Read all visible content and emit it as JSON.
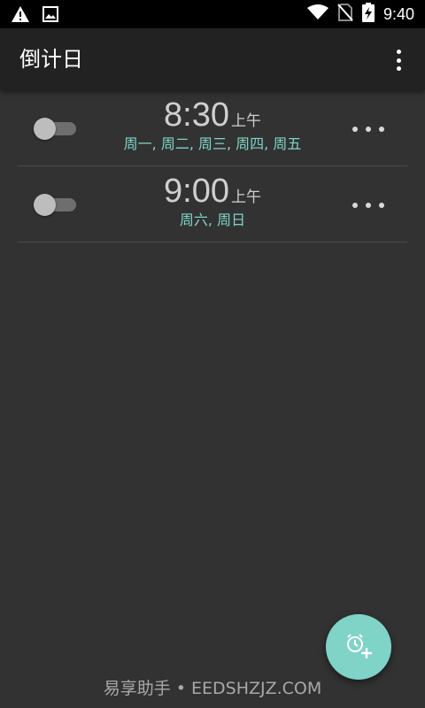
{
  "status_bar": {
    "time": "9:40",
    "icons": [
      "warning-icon",
      "image-icon",
      "wifi-icon",
      "no-sim-icon",
      "battery-charging-icon"
    ]
  },
  "app_bar": {
    "title": "倒计日",
    "menu_icon": "overflow-menu-icon"
  },
  "alarms": [
    {
      "time": "8:30",
      "ampm": "上午",
      "days": "周一, 周二, 周三, 周四, 周五",
      "enabled": false
    },
    {
      "time": "9:00",
      "ampm": "上午",
      "days": "周六, 周日",
      "enabled": false
    }
  ],
  "fab": {
    "icon": "add-alarm-icon"
  },
  "watermark": "易享助手 • EEDSHZJZ.COM",
  "colors": {
    "accent": "#7fd3c7",
    "background": "#323232",
    "app_bar": "#222222"
  }
}
